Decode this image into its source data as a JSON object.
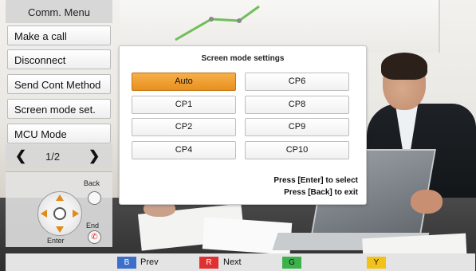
{
  "menu": {
    "title": "Comm. Menu",
    "items": [
      {
        "label": "Make a call"
      },
      {
        "label": "Disconnect"
      },
      {
        "label": "Send Cont Method"
      },
      {
        "label": "Screen mode set."
      },
      {
        "label": "MCU Mode"
      }
    ],
    "pager": {
      "text": "1/2"
    }
  },
  "remote": {
    "back_label": "Back",
    "end_label": "End",
    "enter_label": "Enter"
  },
  "dialog": {
    "title": "Screen mode settings",
    "selected": "Auto",
    "options": [
      "Auto",
      "CP6",
      "CP1",
      "CP8",
      "CP2",
      "CP9",
      "CP4",
      "CP10"
    ],
    "hint_line1": "Press [Enter] to select",
    "hint_line2": "Press [Back] to exit"
  },
  "bottom_keys": [
    {
      "key": "B",
      "label": "Prev",
      "color": "#3b6fc9"
    },
    {
      "key": "R",
      "label": "Next",
      "color": "#e03030"
    },
    {
      "key": "G",
      "label": "",
      "color": "#3bb24a"
    },
    {
      "key": "Y",
      "label": "",
      "color": "#f2c21a"
    }
  ],
  "colors": {
    "accent": "#f0a030"
  }
}
